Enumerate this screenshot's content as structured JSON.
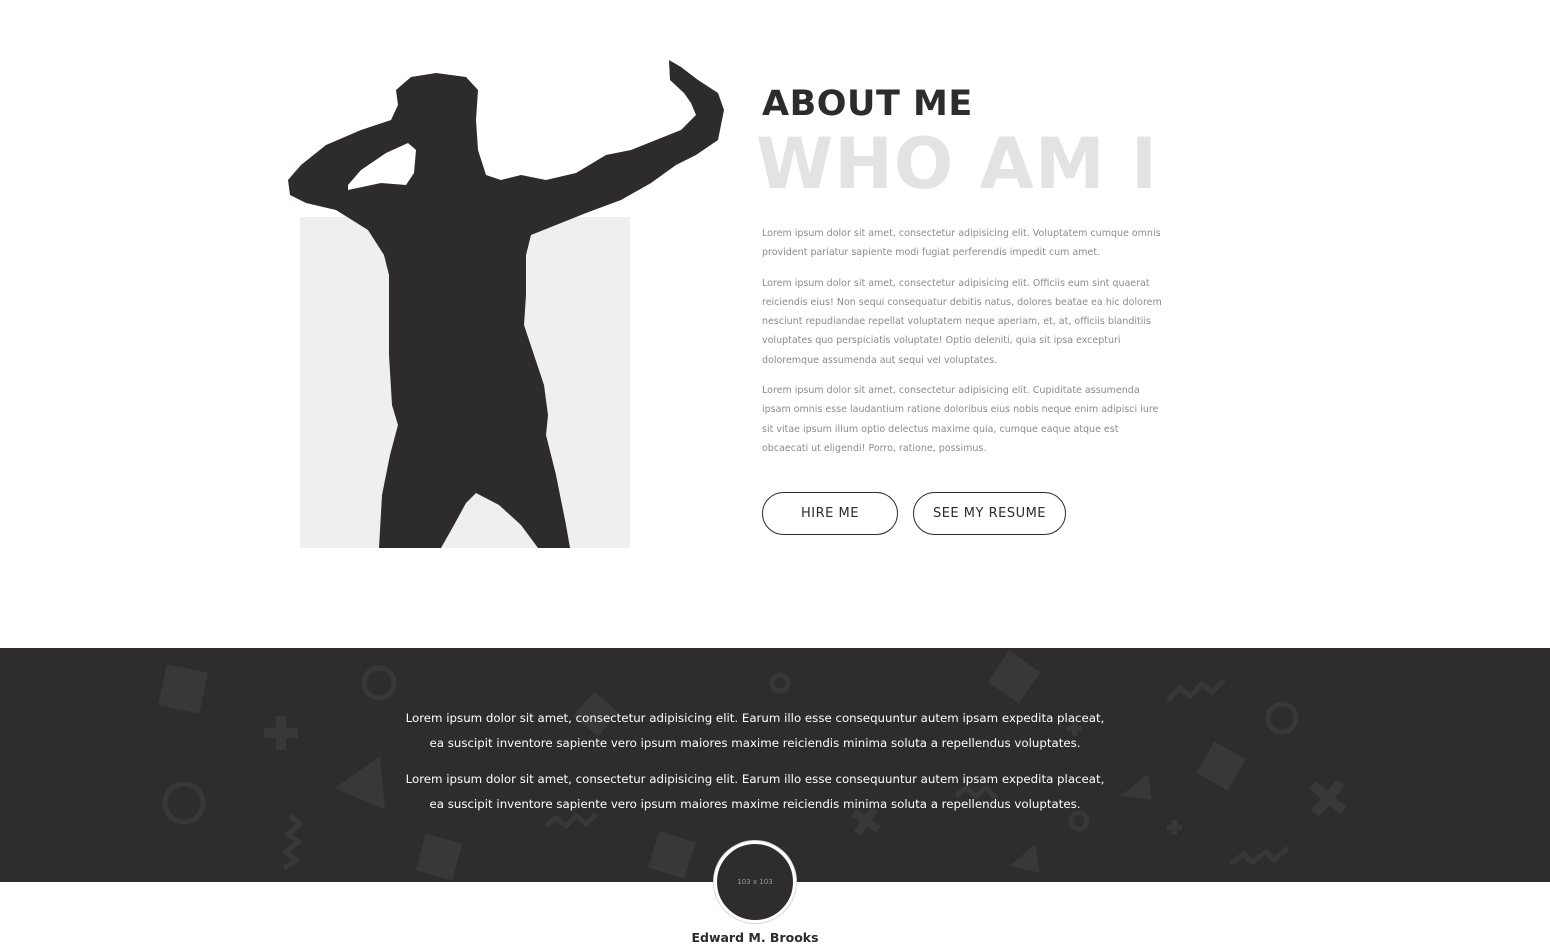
{
  "about": {
    "title": "ABOUT ME",
    "subtitle": "WHO AM I",
    "paragraphs": [
      "Lorem ipsum dolor sit amet, consectetur adipisicing elit. Voluptatem cumque omnis provident pariatur sapiente modi fugiat perferendis impedit cum amet.",
      "Lorem ipsum dolor sit amet, consectetur adipisicing elit. Officiis eum sint quaerat reiciendis eius! Non sequi consequatur debitis natus, dolores beatae ea hic dolorem nesciunt repudiandae repellat voluptatem neque aperiam, et, at, officiis blanditiis voluptates quo perspiciatis voluptate! Optio deleniti, quia sit ipsa excepturi doloremque assumenda aut sequi vel voluptates.",
      "Lorem ipsum dolor sit amet, consectetur adipisicing elit. Cupiditate assumenda ipsam omnis esse laudantium ratione doloribus eius nobis neque enim adipisci iure sit vitae ipsum illum optio delectus maxime quia, cumque eaque atque est obcaecati ut eligendi! Porro, ratione, possimus."
    ],
    "buttons": {
      "hire": "HIRE ME",
      "resume": "SEE MY RESUME"
    }
  },
  "testimonial": {
    "paragraphs": [
      "Lorem ipsum dolor sit amet, consectetur adipisicing elit. Earum illo esse consequuntur autem ipsam expedita placeat, ea suscipit inventore sapiente vero ipsum maiores maxime reiciendis minima soluta a repellendus voluptates.",
      "Lorem ipsum dolor sit amet, consectetur adipisicing elit. Earum illo esse consequuntur autem ipsam expedita placeat, ea suscipit inventore sapiente vero ipsum maiores maxime reiciendis minima soluta a repellendus voluptates."
    ],
    "avatar_placeholder": "103 x 103",
    "author": "Edward M. Brooks"
  },
  "colors": {
    "dark": "#2f2c2d",
    "light_gray": "#efefef",
    "subtitle_gray": "#e3e3e3",
    "text_gray": "#8b8b8b"
  }
}
